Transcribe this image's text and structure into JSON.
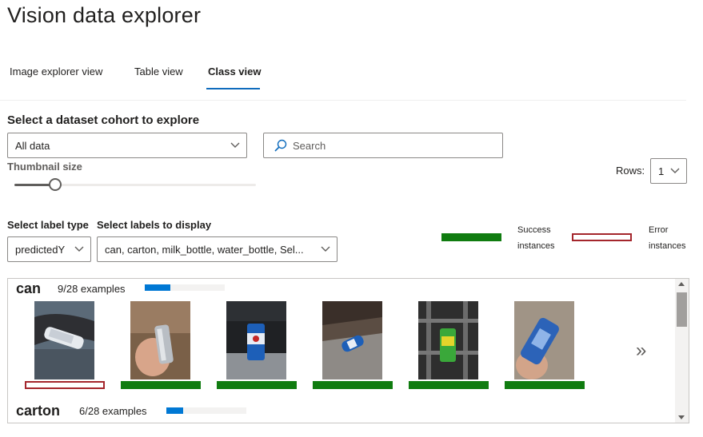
{
  "app": {
    "title": "Vision data explorer"
  },
  "tabs": [
    {
      "label": "Image explorer view",
      "active": false
    },
    {
      "label": "Table view",
      "active": false
    },
    {
      "label": "Class view",
      "active": true
    }
  ],
  "cohort": {
    "title": "Select a dataset cohort to explore",
    "selected": "All data",
    "search_placeholder": "Search"
  },
  "thumbnail": {
    "label": "Thumbnail size",
    "level_fraction": 0.17
  },
  "rows": {
    "label": "Rows:",
    "value": "1"
  },
  "label_type": {
    "title": "Select label type",
    "selected": "predictedY"
  },
  "labels": {
    "title": "Select labels to display",
    "selected": "can, carton, milk_bottle, water_bottle, Sel..."
  },
  "legend": {
    "success_line1": "Success",
    "success_line2": "instances",
    "error_line1": "Error",
    "error_line2": "instances",
    "success_color": "#107c10",
    "error_color": "#a4262c"
  },
  "classes": [
    {
      "name": "can",
      "count_text": "9/28 examples",
      "fraction": 0.32,
      "images": [
        {
          "icon": "water-bottle-photo",
          "status": "error"
        },
        {
          "icon": "silver-can-photo",
          "status": "success"
        },
        {
          "icon": "pepsi-can-photo",
          "status": "success"
        },
        {
          "icon": "pepsi-can-floor-photo",
          "status": "success"
        },
        {
          "icon": "green-can-photo",
          "status": "success"
        },
        {
          "icon": "blue-can-photo",
          "status": "success"
        }
      ]
    },
    {
      "name": "carton",
      "count_text": "6/28 examples",
      "fraction": 0.21
    }
  ],
  "icons": {
    "chevron": "chevron-down-icon",
    "search": "search-icon",
    "next": "double-chevron-right-icon",
    "next_glyph": "»"
  }
}
